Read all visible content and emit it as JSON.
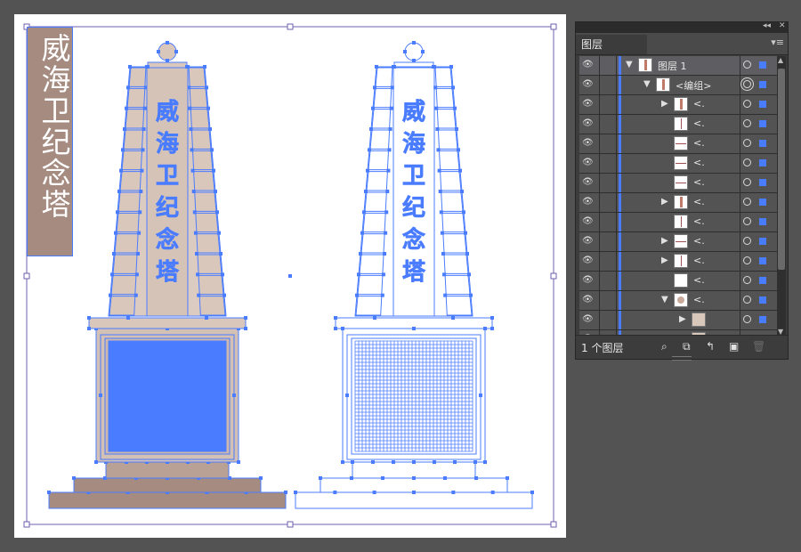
{
  "canvas": {
    "background": "#535353",
    "artboard_color": "#ffffff",
    "selection_color": "#4a7cff",
    "stone_color": "#d9c7bc",
    "base_color": "#a58b80"
  },
  "artwork": {
    "title_vertical": "威海卫纪念塔",
    "inscription_chars": [
      "威",
      "海",
      "卫",
      "纪",
      "念",
      "塔"
    ]
  },
  "layers_panel": {
    "collapse_icon": "double-chevron-left-icon",
    "close_icon": "close-icon",
    "tab_label": "图层",
    "menu_icon": "panel-menu-icon",
    "rows": [
      {
        "indent": 1,
        "arrow": "down",
        "label": "图层 1",
        "thumb": "layer",
        "target": "single",
        "top": true
      },
      {
        "indent": 2,
        "arrow": "down",
        "label": "<编组>",
        "thumb": "group",
        "target": "double"
      },
      {
        "indent": 3,
        "arrow": "right",
        "label": "<.",
        "thumb": "vbar"
      },
      {
        "indent": 3,
        "arrow": "",
        "label": "<.",
        "thumb": "vline"
      },
      {
        "indent": 3,
        "arrow": "",
        "label": "<.",
        "thumb": "hline"
      },
      {
        "indent": 3,
        "arrow": "",
        "label": "<.",
        "thumb": "hline"
      },
      {
        "indent": 3,
        "arrow": "",
        "label": "<.",
        "thumb": "hline"
      },
      {
        "indent": 3,
        "arrow": "right",
        "label": "<.",
        "thumb": "vbar"
      },
      {
        "indent": 3,
        "arrow": "",
        "label": "<.",
        "thumb": "vline"
      },
      {
        "indent": 3,
        "arrow": "right",
        "label": "<.",
        "thumb": "hline"
      },
      {
        "indent": 3,
        "arrow": "right",
        "label": "<.",
        "thumb": "vline"
      },
      {
        "indent": 3,
        "arrow": "",
        "label": "<.",
        "thumb": "blank"
      },
      {
        "indent": 3,
        "arrow": "down",
        "label": "<.",
        "thumb": "circle"
      },
      {
        "indent": 4,
        "arrow": "right",
        "label": "",
        "thumb": "square"
      },
      {
        "indent": 4,
        "arrow": "",
        "label": "",
        "thumb": "square"
      }
    ],
    "footer": {
      "count_label": "1 个图层",
      "icons": [
        "search-icon",
        "make-clipping-mask-icon",
        "new-sublayer-icon",
        "new-layer-icon",
        "delete-icon"
      ]
    }
  }
}
